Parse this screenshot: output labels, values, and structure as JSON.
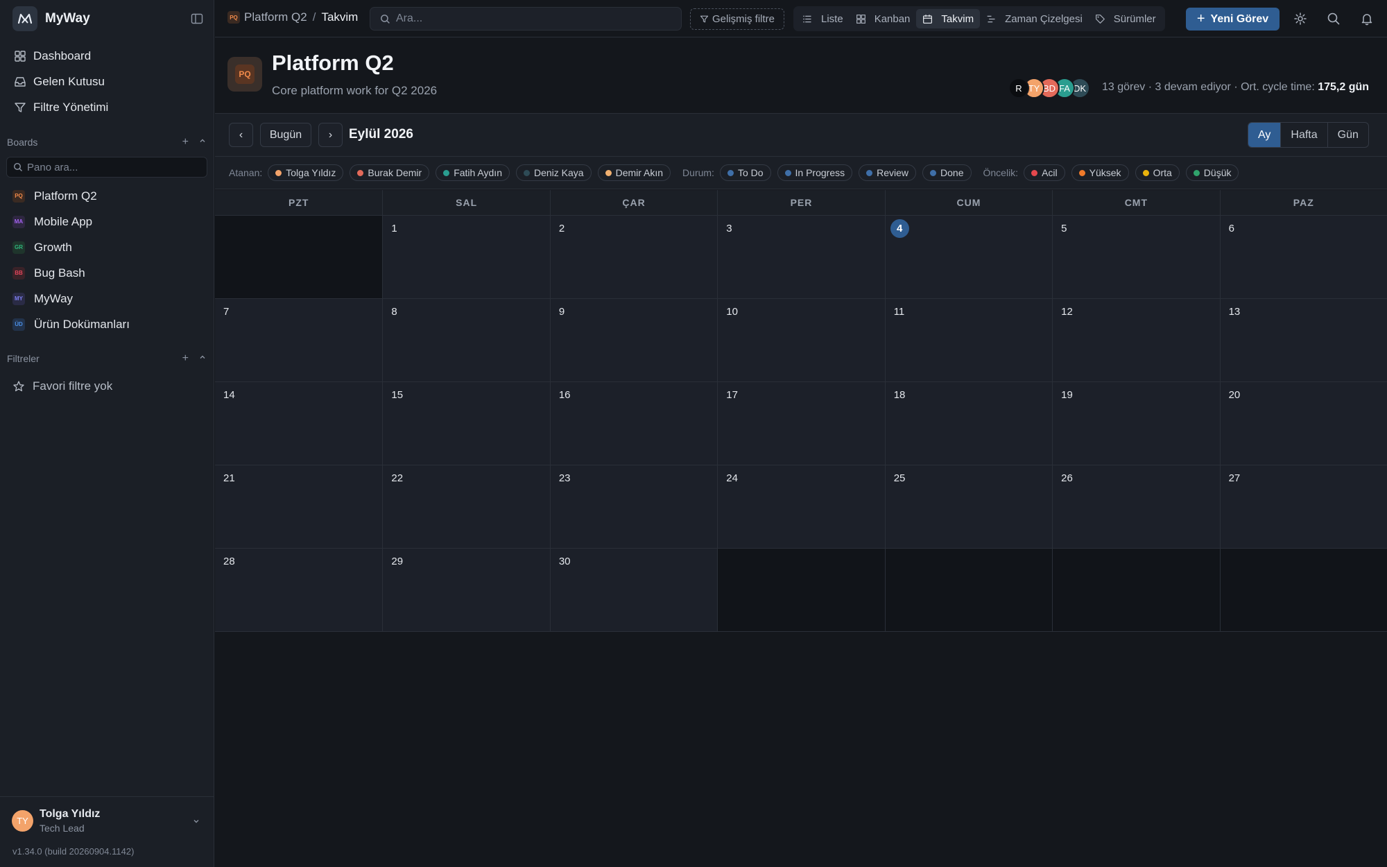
{
  "app": {
    "name": "MyWay",
    "version": "v1.34.0 (build 20260904.1142)"
  },
  "sidebar": {
    "nav": [
      {
        "label": "Dashboard",
        "icon": "grid-icon"
      },
      {
        "label": "Gelen Kutusu",
        "icon": "inbox-icon"
      },
      {
        "label": "Filtre Yönetimi",
        "icon": "filter-icon"
      }
    ],
    "boards_title": "Boards",
    "board_search_placeholder": "Pano ara...",
    "boards": [
      {
        "badge": "PQ",
        "label": "Platform Q2",
        "color": "#f08a4b",
        "bg": "#3a2a22"
      },
      {
        "badge": "MA",
        "label": "Mobile App",
        "color": "#a463f2",
        "bg": "#2e2740"
      },
      {
        "badge": "GR",
        "label": "Growth",
        "color": "#2fb47c",
        "bg": "#1f352c"
      },
      {
        "badge": "BB",
        "label": "Bug Bash",
        "color": "#e0455b",
        "bg": "#3a2228"
      },
      {
        "badge": "MY",
        "label": "MyWay",
        "color": "#7d7ff0",
        "bg": "#2a2b45"
      },
      {
        "badge": "ÜD",
        "label": "Ürün Dokümanları",
        "color": "#4b8fe6",
        "bg": "#22324a"
      }
    ],
    "filters_title": "Filtreler",
    "fav_empty": "Favori filtre yok",
    "user": {
      "initials": "TY",
      "name": "Tolga Yıldız",
      "role": "Tech Lead"
    }
  },
  "topbar": {
    "breadcrumb": {
      "badge": "PQ",
      "project": "Platform Q2",
      "separator": "/",
      "current": "Takvim"
    },
    "search_placeholder": "Ara...",
    "advanced_filter": "Gelişmiş filtre",
    "views": [
      {
        "label": "Liste",
        "icon": "list-icon",
        "active": false
      },
      {
        "label": "Kanban",
        "icon": "kanban-icon",
        "active": false
      },
      {
        "label": "Takvim",
        "icon": "calendar-icon",
        "active": true
      },
      {
        "label": "Zaman Çizelgesi",
        "icon": "timeline-icon",
        "active": false
      },
      {
        "label": "Sürümler",
        "icon": "tag-icon",
        "active": false
      }
    ],
    "new_task": "Yeni Görev"
  },
  "project": {
    "badge": "PQ",
    "title": "Platform Q2",
    "description": "Core platform work for Q2 2026",
    "members": [
      {
        "initials": "R",
        "color": "#0b0d10"
      },
      {
        "initials": "TY",
        "color": "#f3a36a"
      },
      {
        "initials": "BD",
        "color": "#e36a5a"
      },
      {
        "initials": "FA",
        "color": "#2a9d8f"
      },
      {
        "initials": "DK",
        "color": "#2e4b56"
      }
    ],
    "stats_prefix": "13 görev · 3 devam ediyor · Ort. cycle time: ",
    "stats_value": "175,2 gün"
  },
  "calendar": {
    "today_label": "Bugün",
    "prev_label": "‹",
    "next_label": "›",
    "month_title": "Eylül 2026",
    "modes": [
      {
        "label": "Ay",
        "active": true
      },
      {
        "label": "Hafta",
        "active": false
      },
      {
        "label": "Gün",
        "active": false
      }
    ],
    "weekdays": [
      "PZT",
      "SAL",
      "ÇAR",
      "PER",
      "CUM",
      "CMT",
      "PAZ"
    ],
    "leading_blanks": 1,
    "days_in_month": 30,
    "today": 4
  },
  "filters": {
    "assignee_label": "Atanan:",
    "assignees": [
      {
        "label": "Tolga Yıldız",
        "color": "#f3a36a"
      },
      {
        "label": "Burak Demir",
        "color": "#e36a5a"
      },
      {
        "label": "Fatih Aydın",
        "color": "#2a9d8f"
      },
      {
        "label": "Deniz Kaya",
        "color": "#2e4b56"
      },
      {
        "label": "Demir Akın",
        "color": "#f0b070"
      }
    ],
    "status_label": "Durum:",
    "statuses": [
      {
        "label": "To Do",
        "color": "#3f6fa8"
      },
      {
        "label": "In Progress",
        "color": "#3f6fa8"
      },
      {
        "label": "Review",
        "color": "#3f6fa8"
      },
      {
        "label": "Done",
        "color": "#3f6fa8"
      }
    ],
    "priority_label": "Öncelik:",
    "priorities": [
      {
        "label": "Acil",
        "color": "#e5484d"
      },
      {
        "label": "Yüksek",
        "color": "#f07a2a"
      },
      {
        "label": "Orta",
        "color": "#e8b20c"
      },
      {
        "label": "Düşük",
        "color": "#30a46c"
      }
    ]
  }
}
